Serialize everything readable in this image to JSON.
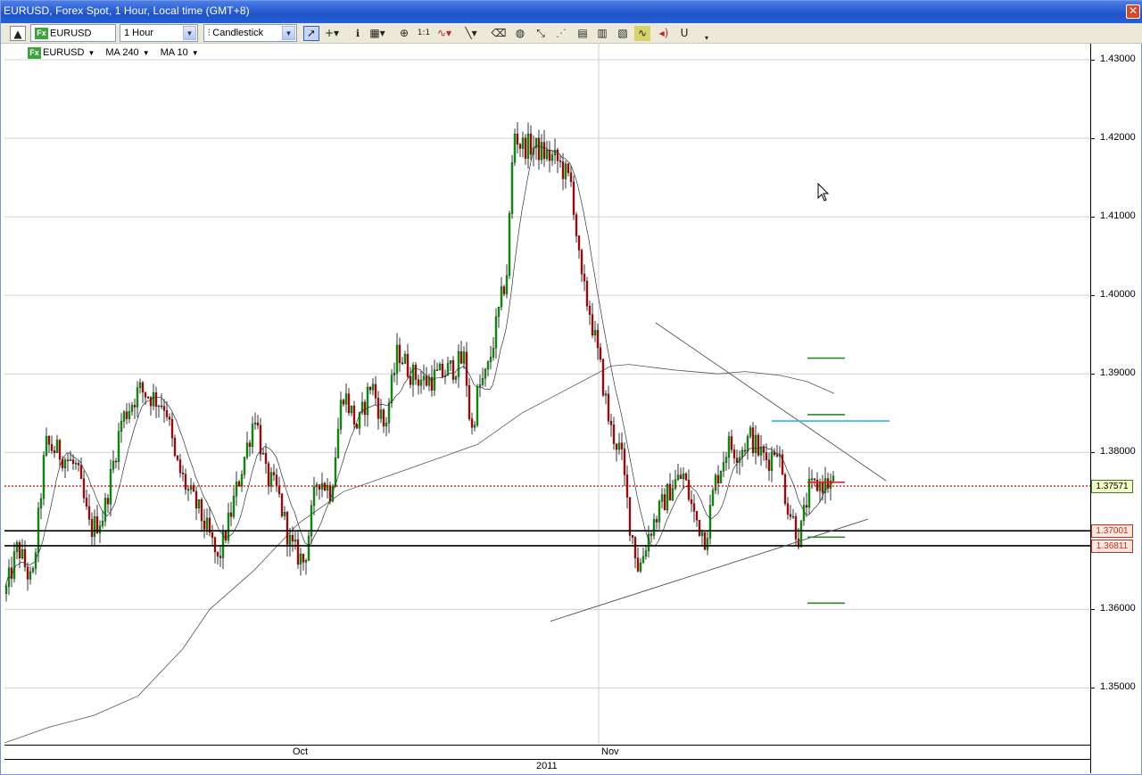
{
  "window": {
    "title": "EURUSD, Forex Spot, 1 Hour, Local time (GMT+8)",
    "close_glyph": "✕"
  },
  "toolbar": {
    "symbol_badge": "Fx",
    "symbol_value": "EURUSD",
    "period_value": "1 Hour",
    "chart_type_value": "Candlestick",
    "icons": [
      "scroll-up-icon",
      "cursor-arrow-icon",
      "crosshair-icon",
      "info-icon",
      "grid-icon",
      "zoom-icon",
      "one-to-one-icon",
      "indicator-icon",
      "line-tool-icon",
      "eraser-icon",
      "color-wheel-icon",
      "rays-icon",
      "pattern-icon",
      "chart-image-1-icon",
      "chart-image-2-icon",
      "chart-image-3-icon",
      "chart-image-4-icon",
      "chart-image-5-icon",
      "sound-icon",
      "magnet-icon",
      "more-icon"
    ]
  },
  "legend": {
    "symbol_badge": "Fx",
    "symbol": "EURUSD",
    "ma_long": "MA 240",
    "ma_short": "MA 10"
  },
  "price_axis": {
    "ticks": [
      "1.43000",
      "1.42000",
      "1.41000",
      "1.40000",
      "1.39000",
      "1.38000",
      "1.36000",
      "1.35000"
    ],
    "current_price_tag": "1.37571",
    "level_tag_1": "1.37001",
    "level_tag_2": "1.36811"
  },
  "time_axis": {
    "month_labels": [
      "Oct",
      "Nov"
    ],
    "year_label": "2011"
  },
  "colors": {
    "bull_candle": "#00aa00",
    "bear_candle": "#cc0000",
    "current_price_line": "#cc0000",
    "level_line": "#000000",
    "cyan_level": "#2fb4e6",
    "green_marker": "#2a8a2a",
    "red_marker": "#dd2222"
  },
  "chart_data": {
    "type": "candlestick",
    "symbol": "EURUSD",
    "timeframe": "1 Hour",
    "ylim": [
      1.3425,
      1.4335
    ],
    "y_ticks": [
      1.43,
      1.42,
      1.41,
      1.4,
      1.39,
      1.38,
      1.36,
      1.35
    ],
    "x_labels": [
      "Oct",
      "Nov"
    ],
    "current_price": 1.37571,
    "horizontal_levels": [
      1.37001,
      1.36811
    ],
    "price_anchors": [
      [
        0,
        1.362
      ],
      [
        14,
        1.368
      ],
      [
        30,
        1.363
      ],
      [
        45,
        1.381
      ],
      [
        60,
        1.38
      ],
      [
        80,
        1.378
      ],
      [
        95,
        1.37
      ],
      [
        110,
        1.372
      ],
      [
        130,
        1.384
      ],
      [
        150,
        1.388
      ],
      [
        165,
        1.387
      ],
      [
        180,
        1.386
      ],
      [
        190,
        1.379
      ],
      [
        205,
        1.375
      ],
      [
        215,
        1.373
      ],
      [
        230,
        1.369
      ],
      [
        238,
        1.366
      ],
      [
        250,
        1.371
      ],
      [
        265,
        1.378
      ],
      [
        280,
        1.385
      ],
      [
        292,
        1.377
      ],
      [
        305,
        1.375
      ],
      [
        320,
        1.368
      ],
      [
        335,
        1.366
      ],
      [
        350,
        1.377
      ],
      [
        365,
        1.375
      ],
      [
        378,
        1.388
      ],
      [
        395,
        1.383
      ],
      [
        410,
        1.389
      ],
      [
        425,
        1.383
      ],
      [
        440,
        1.393
      ],
      [
        455,
        1.39
      ],
      [
        470,
        1.389
      ],
      [
        490,
        1.39
      ],
      [
        505,
        1.391
      ],
      [
        515,
        1.392
      ],
      [
        522,
        1.382
      ],
      [
        530,
        1.388
      ],
      [
        540,
        1.39
      ],
      [
        550,
        1.396
      ],
      [
        562,
        1.403
      ],
      [
        570,
        1.421
      ],
      [
        578,
        1.419
      ],
      [
        590,
        1.419
      ],
      [
        605,
        1.418
      ],
      [
        620,
        1.417
      ],
      [
        635,
        1.414
      ],
      [
        645,
        1.402
      ],
      [
        655,
        1.398
      ],
      [
        668,
        1.39
      ],
      [
        678,
        1.383
      ],
      [
        690,
        1.38
      ],
      [
        700,
        1.371
      ],
      [
        710,
        1.365
      ],
      [
        722,
        1.37
      ],
      [
        735,
        1.373
      ],
      [
        748,
        1.376
      ],
      [
        760,
        1.377
      ],
      [
        772,
        1.372
      ],
      [
        785,
        1.369
      ],
      [
        795,
        1.376
      ],
      [
        810,
        1.381
      ],
      [
        822,
        1.38
      ],
      [
        835,
        1.382
      ],
      [
        845,
        1.38
      ],
      [
        855,
        1.379
      ],
      [
        865,
        1.381
      ],
      [
        875,
        1.374
      ],
      [
        890,
        1.369
      ],
      [
        900,
        1.375
      ],
      [
        912,
        1.376
      ],
      [
        925,
        1.376
      ],
      [
        930,
        1.376
      ]
    ],
    "ma240_anchors": [
      [
        0,
        1.343
      ],
      [
        50,
        1.345
      ],
      [
        100,
        1.3465
      ],
      [
        150,
        1.349
      ],
      [
        200,
        1.355
      ],
      [
        230,
        1.36
      ],
      [
        280,
        1.365
      ],
      [
        330,
        1.371
      ],
      [
        380,
        1.375
      ],
      [
        430,
        1.377
      ],
      [
        480,
        1.379
      ],
      [
        530,
        1.381
      ],
      [
        580,
        1.385
      ],
      [
        630,
        1.388
      ],
      [
        680,
        1.391
      ],
      [
        700,
        1.3912
      ],
      [
        750,
        1.3905
      ],
      [
        800,
        1.39
      ],
      [
        830,
        1.3903
      ],
      [
        870,
        1.3898
      ],
      [
        900,
        1.389
      ],
      [
        930,
        1.3875
      ]
    ],
    "trendlines": [
      {
        "x1": 730,
        "y1": 1.3965,
        "x2": 988,
        "y2": 1.3764
      },
      {
        "x1": 612,
        "y1": 1.3585,
        "x2": 968,
        "y2": 1.3715
      }
    ],
    "markers": [
      {
        "color": "green",
        "x1": 900,
        "x2": 942,
        "y": 1.392
      },
      {
        "color": "green",
        "x1": 900,
        "x2": 942,
        "y": 1.3848
      },
      {
        "color": "cyan",
        "x1": 860,
        "x2": 992,
        "y": 1.384
      },
      {
        "color": "red",
        "x1": 900,
        "x2": 942,
        "y": 1.3762
      },
      {
        "color": "green",
        "x1": 900,
        "x2": 942,
        "y": 1.3692
      },
      {
        "color": "green",
        "x1": 900,
        "x2": 942,
        "y": 1.3608
      }
    ]
  }
}
